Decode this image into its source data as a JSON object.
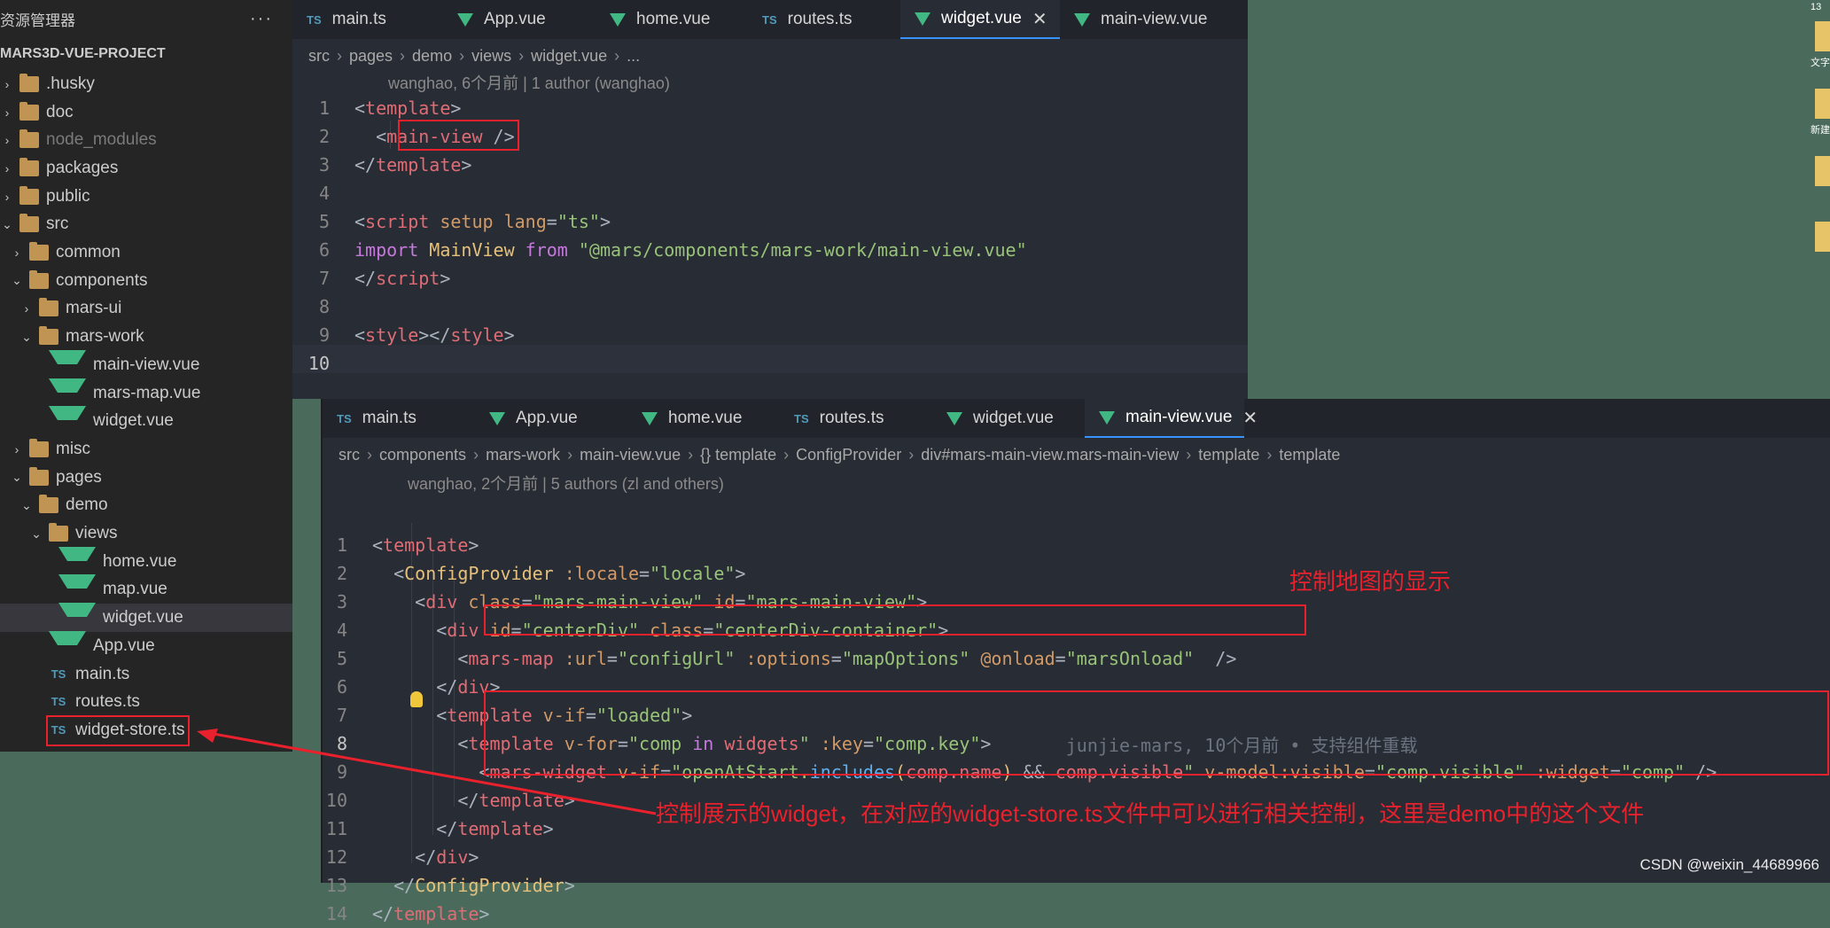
{
  "explorer": {
    "title": "资源管理器",
    "more": "···",
    "project": "MARS3D-VUE-PROJECT",
    "items": [
      {
        "label": ".husky",
        "chev": "›",
        "depth": 0,
        "icon": "folder-icon",
        "dim": false
      },
      {
        "label": "doc",
        "chev": "›",
        "depth": 0,
        "icon": "folder-icon",
        "dim": false
      },
      {
        "label": "node_modules",
        "chev": "›",
        "depth": 0,
        "icon": "folder-icon",
        "dim": true
      },
      {
        "label": "packages",
        "chev": "›",
        "depth": 0,
        "icon": "folder-icon",
        "dim": false
      },
      {
        "label": "public",
        "chev": "›",
        "depth": 0,
        "icon": "folder-icon",
        "dim": false
      },
      {
        "label": "src",
        "chev": "⌄",
        "depth": 0,
        "icon": "folder-icon",
        "dim": false
      },
      {
        "label": "common",
        "chev": "›",
        "depth": 1,
        "icon": "folder-icon",
        "dim": false
      },
      {
        "label": "components",
        "chev": "⌄",
        "depth": 1,
        "icon": "folder-icon",
        "dim": false
      },
      {
        "label": "mars-ui",
        "chev": "›",
        "depth": 2,
        "icon": "folder-icon",
        "dim": false
      },
      {
        "label": "mars-work",
        "chev": "⌄",
        "depth": 2,
        "icon": "folder-icon",
        "dim": false
      },
      {
        "label": "main-view.vue",
        "chev": "",
        "depth": 3,
        "icon": "vue-icon",
        "dim": false
      },
      {
        "label": "mars-map.vue",
        "chev": "",
        "depth": 3,
        "icon": "vue-icon",
        "dim": false
      },
      {
        "label": "widget.vue",
        "chev": "",
        "depth": 3,
        "icon": "vue-icon",
        "dim": false
      },
      {
        "label": "misc",
        "chev": "›",
        "depth": 1,
        "icon": "folder-icon",
        "dim": false
      },
      {
        "label": "pages",
        "chev": "⌄",
        "depth": 1,
        "icon": "folder-icon",
        "dim": false
      },
      {
        "label": "demo",
        "chev": "⌄",
        "depth": 2,
        "icon": "folder-icon",
        "dim": false
      },
      {
        "label": "views",
        "chev": "⌄",
        "depth": 3,
        "icon": "folder-icon",
        "dim": false
      },
      {
        "label": "home.vue",
        "chev": "",
        "depth": 4,
        "icon": "vue-icon",
        "dim": false
      },
      {
        "label": "map.vue",
        "chev": "",
        "depth": 4,
        "icon": "vue-icon",
        "dim": false
      },
      {
        "label": "widget.vue",
        "chev": "",
        "depth": 4,
        "icon": "vue-icon",
        "dim": false,
        "selected": true
      },
      {
        "label": "App.vue",
        "chev": "",
        "depth": 3,
        "icon": "vue-icon",
        "dim": false
      },
      {
        "label": "main.ts",
        "chev": "",
        "depth": 3,
        "icon": "ts-icon",
        "dim": false
      },
      {
        "label": "routes.ts",
        "chev": "",
        "depth": 3,
        "icon": "ts-icon",
        "dim": false
      },
      {
        "label": "widget-store.ts",
        "chev": "",
        "depth": 3,
        "icon": "ts-icon",
        "dim": false
      }
    ]
  },
  "editor1": {
    "tabs": [
      {
        "label": "main.ts",
        "kind": "ts"
      },
      {
        "label": "App.vue",
        "kind": "vue"
      },
      {
        "label": "home.vue",
        "kind": "vue"
      },
      {
        "label": "routes.ts",
        "kind": "ts"
      },
      {
        "label": "widget.vue",
        "kind": "vue",
        "active": true,
        "close": "✕"
      },
      {
        "label": "main-view.vue",
        "kind": "vue"
      }
    ],
    "breadcrumb": [
      "src",
      "pages",
      "demo",
      "views",
      "widget.vue",
      "..."
    ],
    "blame": "wanghao, 6个月前 | 1 author (wanghao)",
    "line_numbers": [
      "1",
      "2",
      "3",
      "4",
      "5",
      "6",
      "7",
      "8",
      "9",
      "10"
    ],
    "lines": [
      [
        [
          "t-p",
          "<"
        ],
        [
          "t",
          "template"
        ],
        [
          "t-p",
          ">"
        ]
      ],
      [
        [
          "t-p",
          "  <"
        ],
        [
          "t",
          "main-view"
        ],
        [
          "t-p",
          " />"
        ]
      ],
      [
        [
          "t-p",
          "</"
        ],
        [
          "t",
          "template"
        ],
        [
          "t-p",
          ">"
        ]
      ],
      [],
      [
        [
          "t-p",
          "<"
        ],
        [
          "t",
          "script"
        ],
        [
          "t-a",
          " setup"
        ],
        [
          "t-a",
          " lang"
        ],
        [
          "t-p",
          "="
        ],
        [
          "t-s",
          "\"ts\""
        ],
        [
          "t-p",
          ">"
        ]
      ],
      [
        [
          "t-k",
          "import"
        ],
        [
          "t-c",
          " MainView"
        ],
        [
          "t-k",
          " from"
        ],
        [
          "t-s",
          " \"@mars/components/mars-work/main-view.vue\""
        ]
      ],
      [
        [
          "t-p",
          "</"
        ],
        [
          "t",
          "script"
        ],
        [
          "t-p",
          ">"
        ]
      ],
      [],
      [
        [
          "t-p",
          "<"
        ],
        [
          "t",
          "style"
        ],
        [
          "t-p",
          "></"
        ],
        [
          "t",
          "style"
        ],
        [
          "t-p",
          ">"
        ]
      ],
      []
    ]
  },
  "editor2": {
    "tabs": [
      {
        "label": "main.ts",
        "kind": "ts"
      },
      {
        "label": "App.vue",
        "kind": "vue"
      },
      {
        "label": "home.vue",
        "kind": "vue"
      },
      {
        "label": "routes.ts",
        "kind": "ts"
      },
      {
        "label": "widget.vue",
        "kind": "vue"
      },
      {
        "label": "main-view.vue",
        "kind": "vue",
        "active": true,
        "close": "✕"
      }
    ],
    "breadcrumb": [
      "src",
      "components",
      "mars-work",
      "main-view.vue",
      "{} template",
      "ConfigProvider",
      "div#mars-main-view.mars-main-view",
      "template",
      "template"
    ],
    "blame": "wanghao, 2个月前 | 5 authors (zl and others)",
    "line_numbers": [
      "1",
      "2",
      "3",
      "4",
      "5",
      "6",
      "7",
      "8",
      "9",
      "10",
      "11",
      "12",
      "13",
      "14"
    ],
    "lines": [
      [
        [
          "t-p",
          "<"
        ],
        [
          "t",
          "template"
        ],
        [
          "t-p",
          ">"
        ]
      ],
      [
        [
          "t-p",
          "  <"
        ],
        [
          "t-c",
          "ConfigProvider"
        ],
        [
          "t-a",
          " :locale"
        ],
        [
          "t-p",
          "="
        ],
        [
          "t-s",
          "\"locale\""
        ],
        [
          "t-p",
          ">"
        ]
      ],
      [
        [
          "t-p",
          "    <"
        ],
        [
          "t",
          "div"
        ],
        [
          "t-a",
          " class"
        ],
        [
          "t-p",
          "="
        ],
        [
          "t-s",
          "\"mars-main-view\""
        ],
        [
          "t-a",
          " id"
        ],
        [
          "t-p",
          "="
        ],
        [
          "t-s",
          "\"mars-main-view\""
        ],
        [
          "t-p",
          ">"
        ]
      ],
      [
        [
          "t-p",
          "      <"
        ],
        [
          "t",
          "div"
        ],
        [
          "t-a",
          " id"
        ],
        [
          "t-p",
          "="
        ],
        [
          "t-s",
          "\"centerDiv\""
        ],
        [
          "t-a",
          " class"
        ],
        [
          "t-p",
          "="
        ],
        [
          "t-s",
          "\"centerDiv-container\""
        ],
        [
          "t-p",
          ">"
        ]
      ],
      [
        [
          "t-p",
          "        <"
        ],
        [
          "t",
          "mars-map"
        ],
        [
          "t-a",
          " :url"
        ],
        [
          "t-p",
          "="
        ],
        [
          "t-s",
          "\"configUrl\""
        ],
        [
          "t-a",
          " :options"
        ],
        [
          "t-p",
          "="
        ],
        [
          "t-s",
          "\"mapOptions\""
        ],
        [
          "t-a",
          " @onload"
        ],
        [
          "t-p",
          "="
        ],
        [
          "t-s",
          "\"marsOnload\""
        ],
        [
          "t-p",
          "  />"
        ]
      ],
      [
        [
          "t-p",
          "      </"
        ],
        [
          "t",
          "div"
        ],
        [
          "t-p",
          ">"
        ]
      ],
      [
        [
          "t-p",
          "      <"
        ],
        [
          "t",
          "template"
        ],
        [
          "t-a",
          " v-if"
        ],
        [
          "t-p",
          "="
        ],
        [
          "t-s",
          "\"loaded\""
        ],
        [
          "t-p",
          ">"
        ]
      ],
      [
        [
          "t-p",
          "        <"
        ],
        [
          "t",
          "template"
        ],
        [
          "t-a",
          " v-for"
        ],
        [
          "t-p",
          "="
        ],
        [
          "t-s",
          "\"comp "
        ],
        [
          "t-k",
          "in"
        ],
        [
          "t-s",
          " "
        ],
        [
          "t-v",
          "widgets"
        ],
        [
          "t-s",
          "\""
        ],
        [
          "t-a",
          " :key"
        ],
        [
          "t-p",
          "="
        ],
        [
          "t-s",
          "\"comp.key\""
        ],
        [
          "t-p",
          ">"
        ],
        [
          "t-cmt",
          "       junjie-mars, 10个月前 • 支持组件重载"
        ]
      ],
      [
        [
          "t-p",
          "          <"
        ],
        [
          "t",
          "mars-widget"
        ],
        [
          "t-a",
          " v-if"
        ],
        [
          "t-p",
          "="
        ],
        [
          "t-s",
          "\"openAtStart."
        ],
        [
          "t-f",
          "includes"
        ],
        [
          "t-c",
          "("
        ],
        [
          "t-v",
          "comp.name"
        ],
        [
          "t-c",
          ")"
        ],
        [
          "t-p",
          " && "
        ],
        [
          "t-v",
          "comp.visible"
        ],
        [
          "t-s",
          "\""
        ],
        [
          "t-a",
          " v-model:visible"
        ],
        [
          "t-p",
          "="
        ],
        [
          "t-s",
          "\"comp.visible\""
        ],
        [
          "t-a",
          " :widget"
        ],
        [
          "t-p",
          "="
        ],
        [
          "t-s",
          "\"comp\""
        ],
        [
          "t-p",
          " />"
        ]
      ],
      [
        [
          "t-p",
          "        </"
        ],
        [
          "t",
          "template"
        ],
        [
          "t-p",
          ">"
        ]
      ],
      [
        [
          "t-p",
          "      </"
        ],
        [
          "t",
          "template"
        ],
        [
          "t-p",
          ">"
        ]
      ],
      [
        [
          "t-p",
          "    </"
        ],
        [
          "t",
          "div"
        ],
        [
          "t-p",
          ">"
        ]
      ],
      [
        [
          "t-p",
          "  </"
        ],
        [
          "t-c",
          "ConfigProvider"
        ],
        [
          "t-p",
          ">"
        ]
      ],
      [
        [
          "t-p",
          "</"
        ],
        [
          "t",
          "template"
        ],
        [
          "t-p",
          ">"
        ]
      ]
    ]
  },
  "annotations": {
    "map_note": "控制地图的显示",
    "widget_note": "控制展示的widget，在对应的widget-store.ts文件中可以进行相关控制，这里是demo中的这个文件"
  },
  "desktop": {
    "labels": [
      "13",
      "文字",
      "新建"
    ]
  },
  "watermark": "CSDN @weixin_44689966",
  "colors": {
    "annotation": "#e8212d",
    "vue": "#41b883",
    "ts": "#519aba",
    "folder": "#c09553"
  }
}
